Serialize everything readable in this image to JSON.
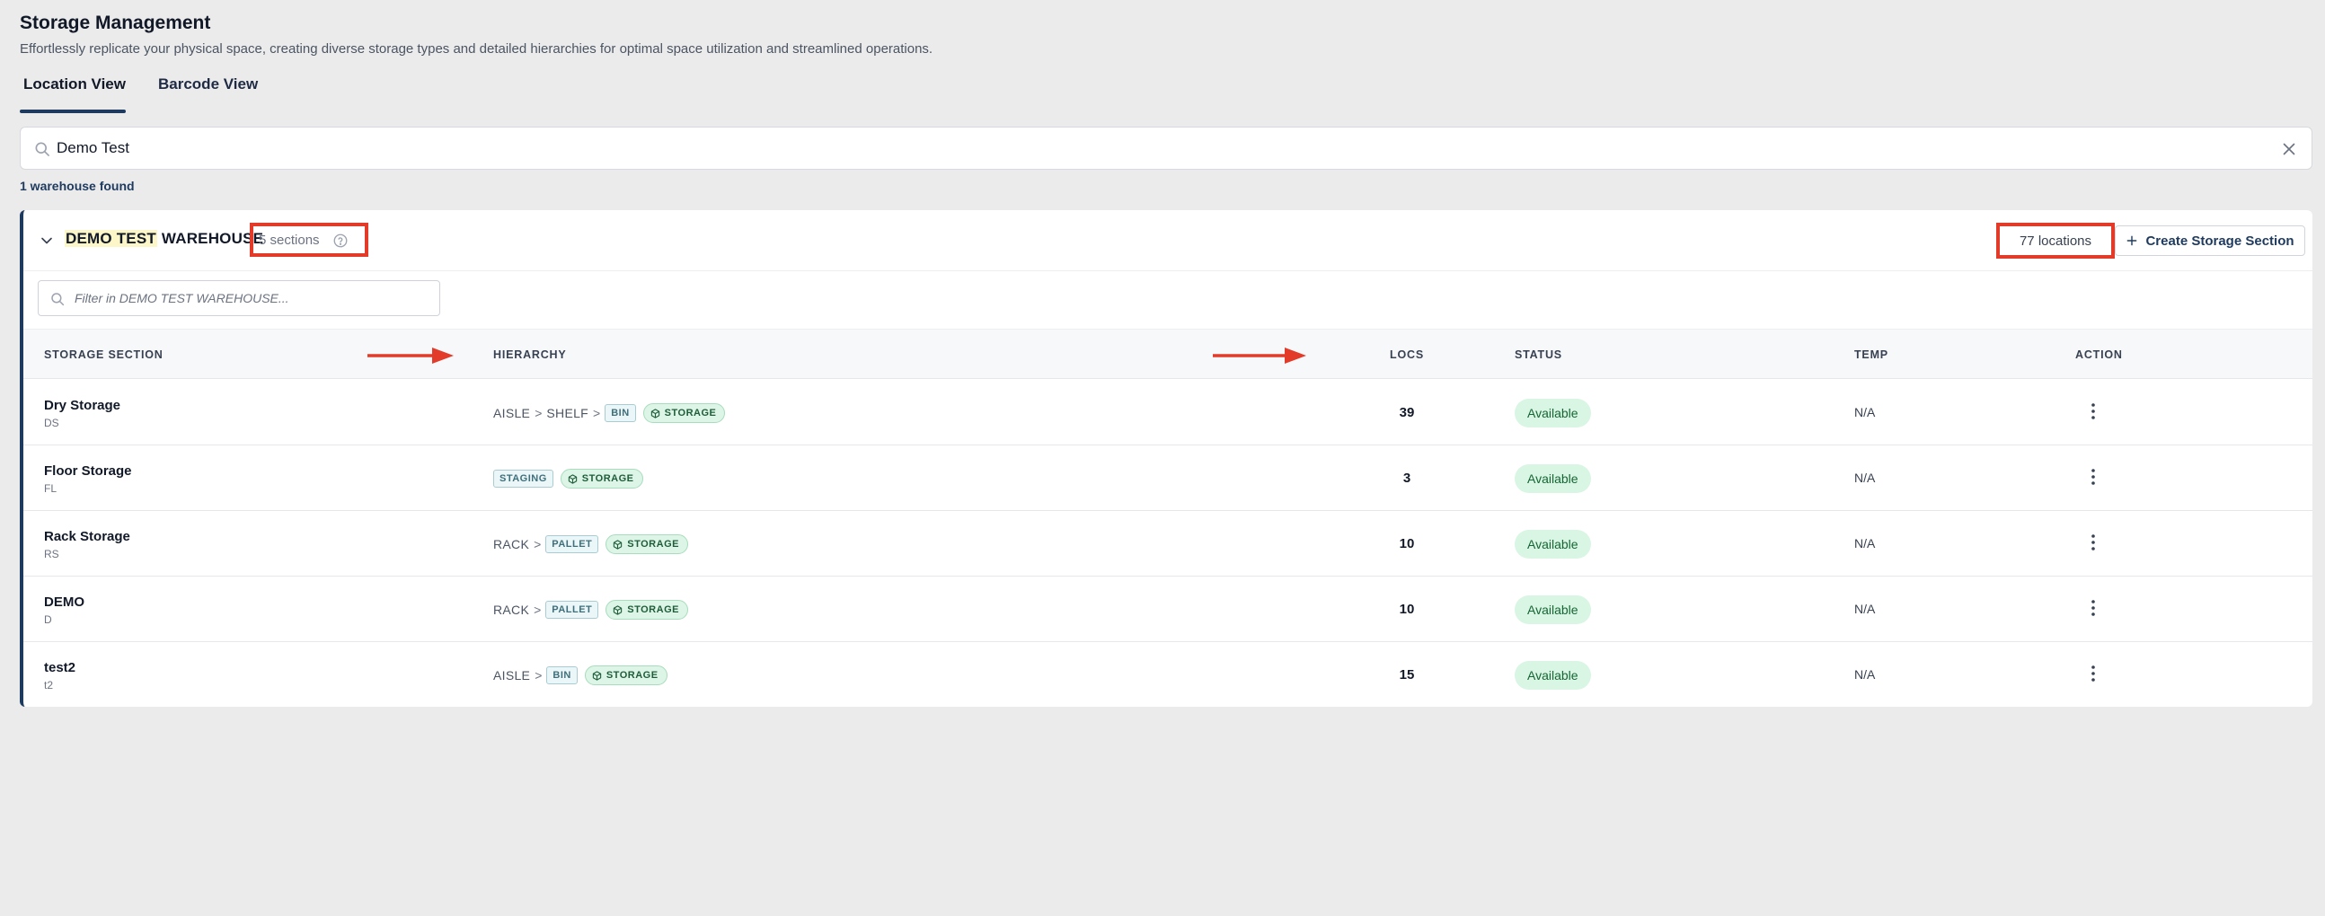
{
  "page": {
    "title": "Storage Management",
    "description": "Effortlessly replicate your physical space, creating diverse storage types and detailed hierarchies for optimal space utilization and streamlined operations."
  },
  "tabs": [
    {
      "label": "Location View",
      "active": true
    },
    {
      "label": "Barcode View",
      "active": false
    }
  ],
  "search": {
    "value": "Demo Test",
    "result_count": "1 warehouse found"
  },
  "warehouse": {
    "name_highlight": "DEMO TEST",
    "name_rest": " WAREHOUSE",
    "sections": "5 sections",
    "locations": "77 locations",
    "create_label": "Create Storage Section",
    "filter_placeholder": "Filter in DEMO TEST WAREHOUSE..."
  },
  "table": {
    "headers": {
      "section": "STORAGE SECTION",
      "hierarchy": "HIERARCHY",
      "locs": "LOCS",
      "status": "STATUS",
      "temp": "TEMP",
      "action": "ACTION"
    },
    "rows": [
      {
        "name": "Dry Storage",
        "code": "DS",
        "levels": [
          "AISLE",
          "SHELF"
        ],
        "tag": "BIN",
        "type": "STORAGE",
        "locs": "39",
        "status": "Available",
        "temp": "N/A"
      },
      {
        "name": "Floor Storage",
        "code": "FL",
        "levels": [],
        "tag": "STAGING",
        "type": "STORAGE",
        "locs": "3",
        "status": "Available",
        "temp": "N/A"
      },
      {
        "name": "Rack Storage",
        "code": "RS",
        "levels": [
          "RACK"
        ],
        "tag": "PALLET",
        "type": "STORAGE",
        "locs": "10",
        "status": "Available",
        "temp": "N/A"
      },
      {
        "name": "DEMO",
        "code": "D",
        "levels": [
          "RACK"
        ],
        "tag": "PALLET",
        "type": "STORAGE",
        "locs": "10",
        "status": "Available",
        "temp": "N/A"
      },
      {
        "name": "test2",
        "code": "t2",
        "levels": [
          "AISLE"
        ],
        "tag": "BIN",
        "type": "STORAGE",
        "locs": "15",
        "status": "Available",
        "temp": "N/A"
      }
    ]
  },
  "colors": {
    "accent": "#1e3a5f",
    "annotation": "#e23b2a",
    "status_bg": "#d8f6e3",
    "status_text": "#166534"
  },
  "icons": {
    "search": "search-icon",
    "clear": "close-icon",
    "collapse": "chevron-down-icon",
    "help": "help-circle-icon",
    "add": "plus-icon",
    "storage": "box-icon",
    "action": "more-vertical-icon"
  }
}
